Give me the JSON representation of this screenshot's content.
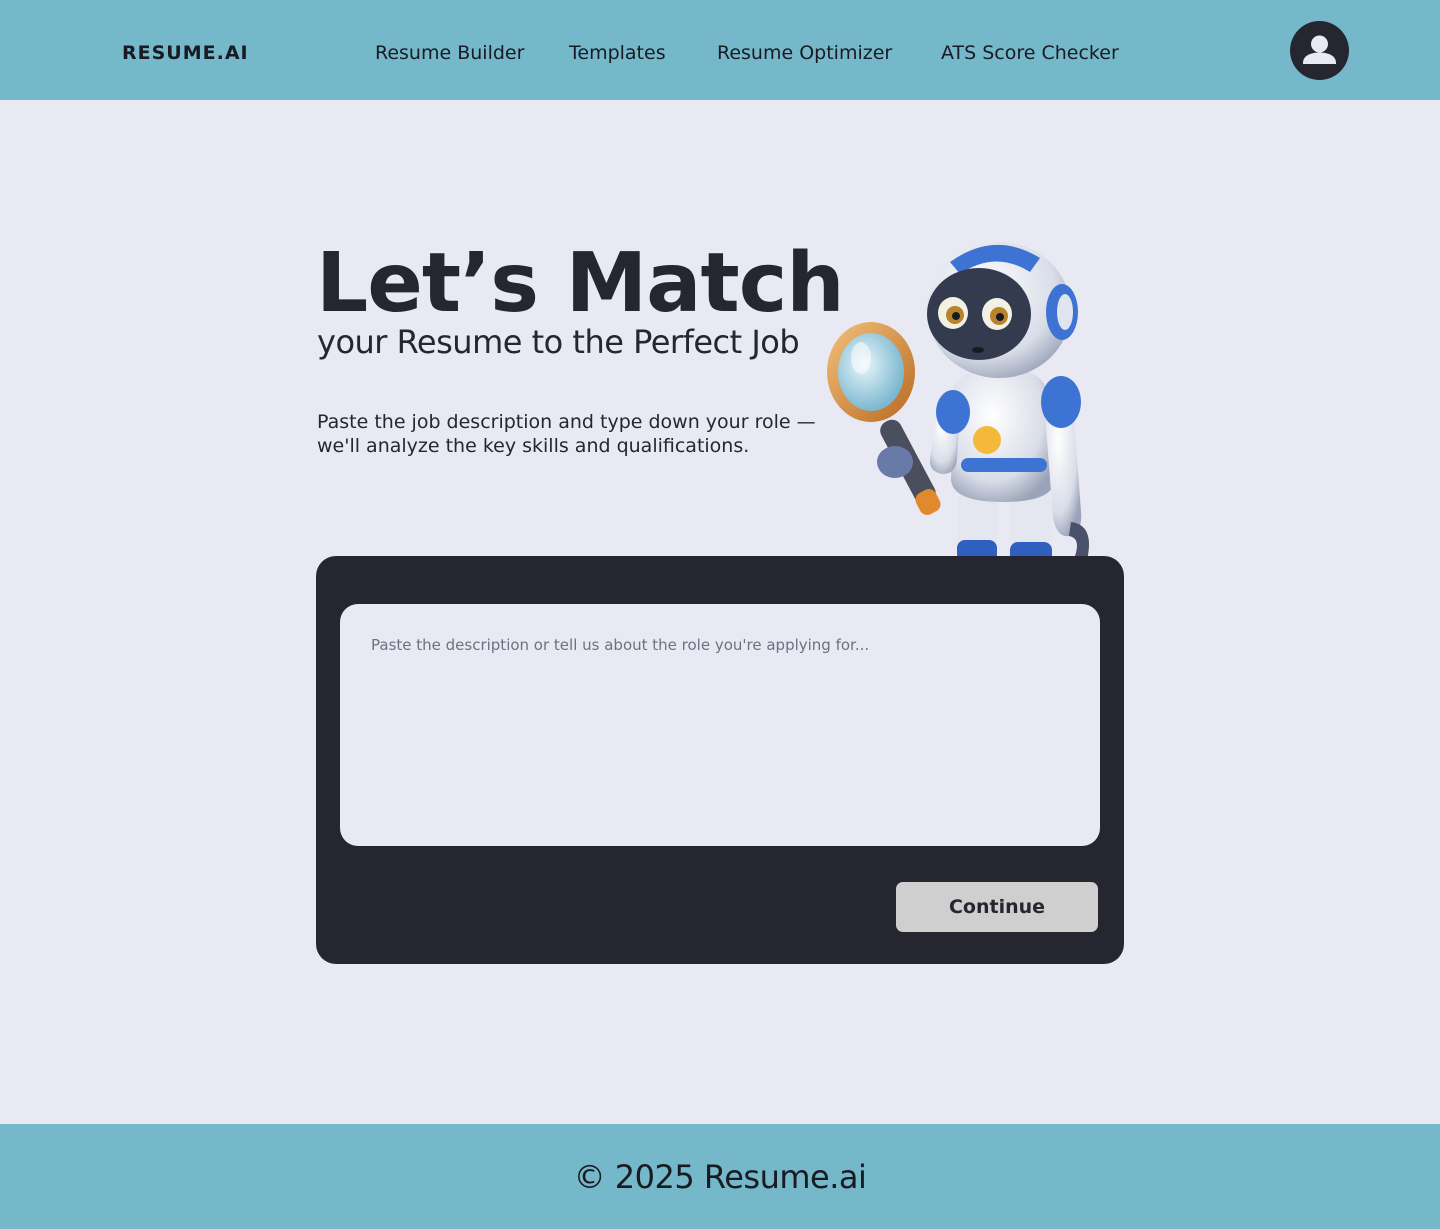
{
  "header": {
    "logo": "RESUME.AI",
    "nav": [
      {
        "label": "Resume Builder"
      },
      {
        "label": "Templates"
      },
      {
        "label": "Resume Optimizer"
      },
      {
        "label": "ATS Score Checker"
      }
    ],
    "avatar_icon": "user-icon"
  },
  "hero": {
    "title": "Let’s Match",
    "subtitle": "your Resume to the Perfect Job",
    "description": "Paste the job description and type down your role — we'll analyze the key skills and qualifications.",
    "illustration_icon": "robot-with-magnifying-glass"
  },
  "form": {
    "textarea_placeholder": "Paste the description or tell us about the role you're applying for...",
    "textarea_value": "",
    "continue_label": "Continue"
  },
  "footer": {
    "copyright": "© 2025 Resume.ai"
  },
  "colors": {
    "header_bg": "#74b8c9",
    "page_bg": "#e8e9f3",
    "dark_panel": "#262631",
    "button_bg": "#cfcfcf"
  }
}
